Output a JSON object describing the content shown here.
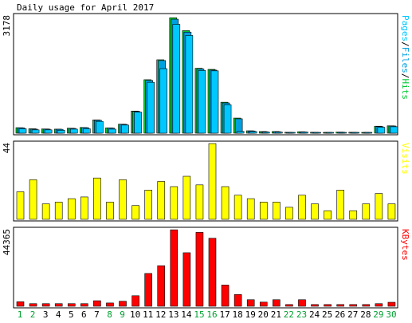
{
  "chart_data": {
    "type": "bar",
    "title": "Daily usage for April 2017",
    "colors": {
      "frame_bg": "#ffffff",
      "panel_border": "#000000",
      "hits": "#00cc33",
      "files": "#00a0e0",
      "pages": "#00c8ff",
      "visits": "#ffff00",
      "kbytes": "#ff0000",
      "weekday_label": "#000000",
      "weekend_label": "#00a030"
    },
    "days": [
      "1",
      "2",
      "3",
      "4",
      "5",
      "6",
      "7",
      "8",
      "9",
      "10",
      "11",
      "12",
      "13",
      "14",
      "15",
      "16",
      "17",
      "18",
      "19",
      "20",
      "21",
      "22",
      "23",
      "24",
      "25",
      "26",
      "27",
      "28",
      "29",
      "30"
    ],
    "weekend_days": [
      "1",
      "2",
      "8",
      "9",
      "15",
      "16",
      "22",
      "23",
      "29",
      "30"
    ],
    "panels": [
      {
        "id": "pages-files-hits",
        "max_label": "3178",
        "legend": [
          "Pages",
          "/",
          "Files",
          "/",
          "Hits"
        ],
        "legend_colors": [
          "#00c8ff",
          "#000000",
          "#00a0e0",
          "#000000",
          "#00cc33"
        ],
        "ylim": [
          0,
          3178
        ],
        "series": [
          {
            "name": "Hits",
            "values": [
              150,
              120,
              115,
              110,
              135,
              155,
              360,
              145,
              245,
              600,
              1450,
              1990,
              3130,
              2780,
              1760,
              1730,
              840,
              410,
              65,
              45,
              45,
              25,
              40,
              25,
              20,
              30,
              25,
              20,
              190,
              200
            ]
          },
          {
            "name": "Files",
            "values": [
              145,
              110,
              110,
              105,
              130,
              150,
              350,
              140,
              240,
              590,
              1430,
              1970,
              3090,
              2740,
              1740,
              1710,
              820,
              390,
              60,
              40,
              40,
              20,
              35,
              20,
              15,
              25,
              20,
              15,
              180,
              195
            ]
          },
          {
            "name": "Pages",
            "values": [
              120,
              90,
              90,
              80,
              110,
              120,
              320,
              110,
              220,
              570,
              1380,
              1750,
              2950,
              2650,
              1700,
              1690,
              770,
              50,
              45,
              30,
              30,
              15,
              30,
              15,
              10,
              20,
              15,
              10,
              160,
              175
            ]
          }
        ]
      },
      {
        "id": "visits",
        "max_label": "44",
        "legend": [
          "Visits"
        ],
        "legend_colors": [
          "#ffff00"
        ],
        "ylim": [
          0,
          44
        ],
        "series": [
          {
            "name": "Visits",
            "values": [
              16,
              23,
              9,
              10,
              12,
              13,
              24,
              10,
              23,
              8,
              17,
              22,
              19,
              25,
              20,
              44,
              19,
              14,
              12,
              10,
              10,
              7,
              14,
              9,
              5,
              17,
              5,
              9,
              15,
              9
            ]
          }
        ]
      },
      {
        "id": "kbytes",
        "max_label": "44365",
        "legend": [
          "KBytes"
        ],
        "legend_colors": [
          "#ff0000"
        ],
        "ylim": [
          0,
          44365
        ],
        "series": [
          {
            "name": "KBytes",
            "values": [
              2600,
              1500,
              1500,
              1500,
              1500,
              1500,
              3200,
              1900,
              2900,
              6100,
              19000,
              23500,
              44300,
              31000,
              42800,
              39400,
              12300,
              6800,
              3800,
              2400,
              3800,
              1000,
              3800,
              1000,
              1000,
              1000,
              1000,
              1000,
              1500,
              2300
            ]
          }
        ]
      }
    ]
  }
}
